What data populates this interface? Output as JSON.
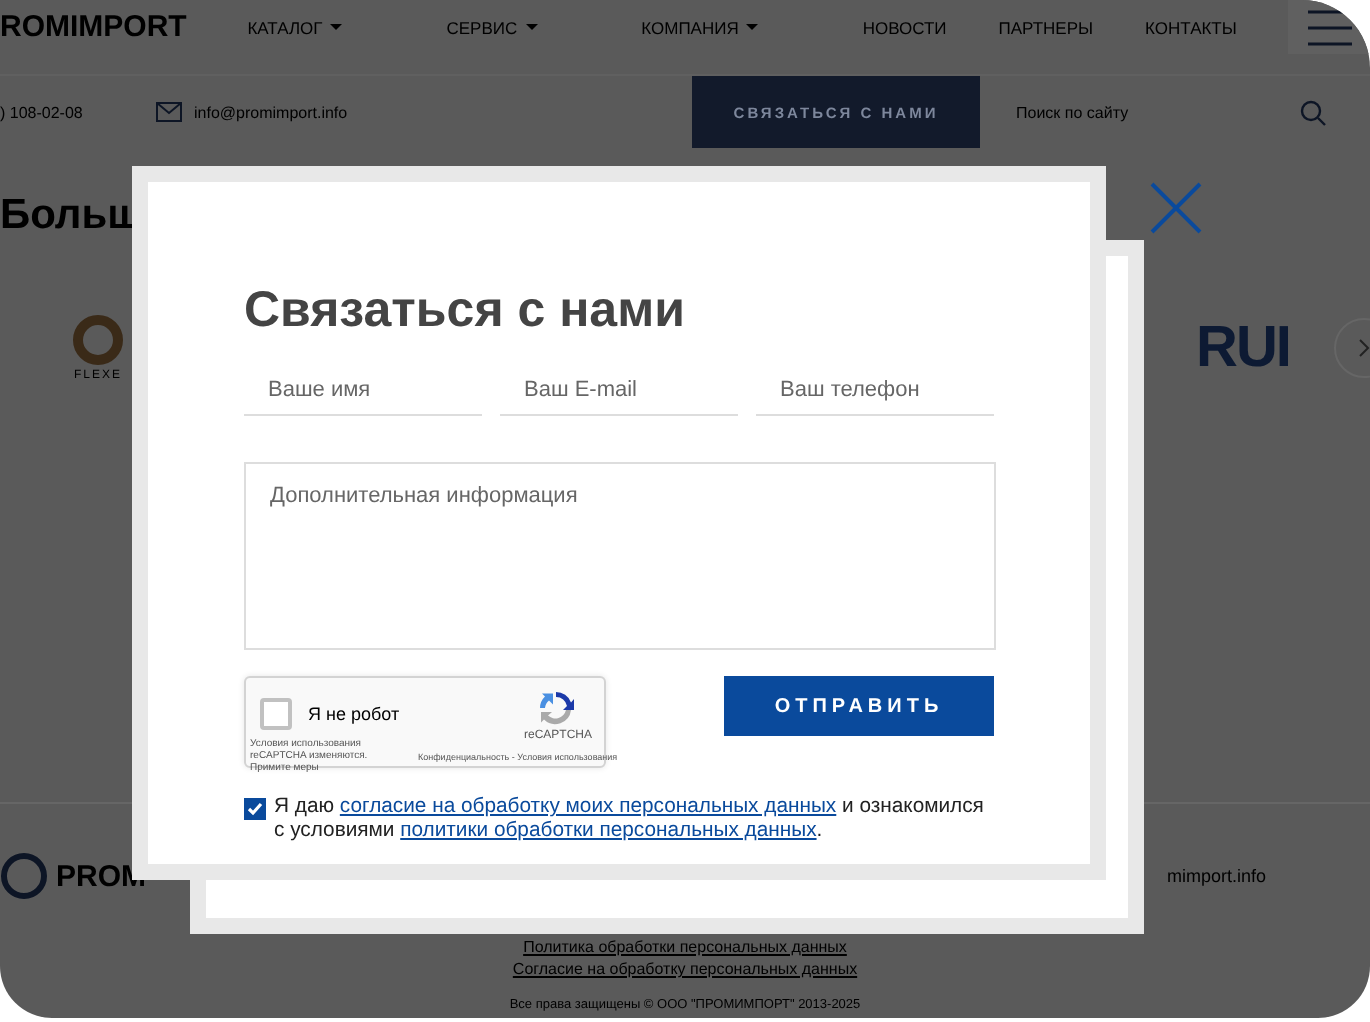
{
  "page": {
    "logo": "ROMIMPORT",
    "nav": [
      {
        "label": "КАТАЛОГ",
        "dropdown": true
      },
      {
        "label": "СЕРВИС",
        "dropdown": true
      },
      {
        "label": "КОМПАНИЯ",
        "dropdown": true
      },
      {
        "label": "НОВОСТИ",
        "dropdown": false
      },
      {
        "label": "ПАРТНЕРЫ",
        "dropdown": false
      },
      {
        "label": "КОНТАКТЫ",
        "dropdown": false
      }
    ],
    "phone": ") 108-02-08",
    "email": "info@promimport.info",
    "contact_button": "СВЯЗАТЬСЯ С НАМИ",
    "search": {
      "placeholder": "Поиск по сайту"
    },
    "heading": "Больш",
    "brand_logos": [
      {
        "text": "FLEXE"
      },
      {
        "text": "RUI"
      }
    ],
    "footer": {
      "logo": "PROM",
      "email": "mimport.info",
      "links": [
        "Политика обработки персональных данных",
        "Согласие на обработку персональных данных"
      ],
      "copyright": "Все права защищены © ООО \"ПРОМИМПОРТ\" 2013-2025"
    }
  },
  "modal": {
    "title": "Связаться с нами",
    "fields": [
      {
        "placeholder": "Ваше имя"
      },
      {
        "placeholder": "Ваш E-mail"
      },
      {
        "placeholder": "Ваш телефон"
      }
    ],
    "textarea": {
      "placeholder": "Дополнительная информация"
    },
    "captcha": {
      "label": "Я не робот",
      "checked": false,
      "brand": "reCAPTCHA",
      "notice": "Условия использования reCAPTCHA изменяются.",
      "notice_link": "Примите меры",
      "footer": "Конфиденциальность - Условия использования"
    },
    "submit": "ОТПРАВИТЬ",
    "consent": {
      "checked": true,
      "parts": [
        {
          "kind": "text",
          "text": "Я даю "
        },
        {
          "kind": "link",
          "text": "согласие на обработку моих персональных данных"
        },
        {
          "kind": "text",
          "text": " и ознакомился с условиями "
        },
        {
          "kind": "link",
          "text": "политики обработки персональных данных"
        },
        {
          "kind": "text",
          "text": "."
        }
      ]
    }
  }
}
